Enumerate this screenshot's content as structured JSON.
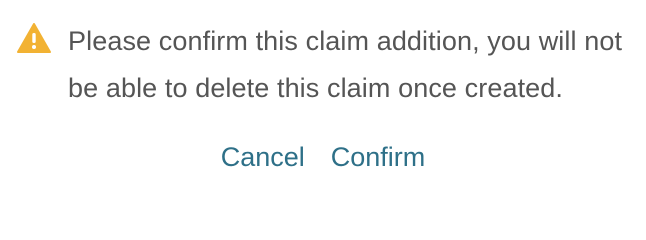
{
  "dialog": {
    "icon": "warning-icon",
    "icon_color": "#f2b233",
    "message": "Please confirm this claim addition, you will not be able to delete this claim once created.",
    "cancel_label": "Cancel",
    "confirm_label": "Confirm",
    "link_color": "#2e7088"
  }
}
